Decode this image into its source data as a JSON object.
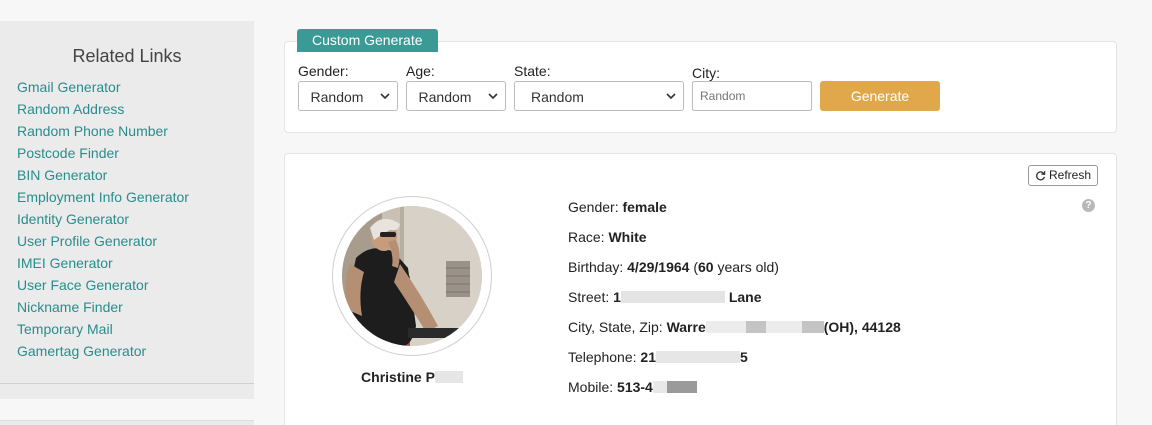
{
  "sidebar": {
    "title": "Related Links",
    "links": [
      "Gmail Generator",
      "Random Address",
      "Random Phone Number",
      "Postcode Finder",
      "BIN Generator",
      "Employment Info Generator",
      "Identity Generator",
      "User Profile Generator",
      "IMEI Generator",
      "User Face Generator",
      "Nickname Finder",
      "Temporary Mail",
      "Gamertag Generator"
    ]
  },
  "generator": {
    "tab_label": "Custom Generate",
    "gender_label": "Gender:",
    "gender_value": "Random",
    "age_label": "Age:",
    "age_value": "Random",
    "state_label": "State:",
    "state_value": "Random",
    "city_label": "City:",
    "city_placeholder": "Random",
    "generate_label": "Generate"
  },
  "profile": {
    "refresh_label": "Refresh",
    "name": "Christine P",
    "gender_label": "Gender:",
    "gender": "female",
    "race_label": "Race:",
    "race": "White",
    "birthday_label": "Birthday:",
    "birthday": "4/29/1964",
    "age": "60",
    "age_suffix": "years old)",
    "street_label": "Street:",
    "street_visible": "1",
    "street_tail": "Lane",
    "city_label": "City, State, Zip:",
    "city_start": "Warre",
    "city_tail": "(OH), 44128",
    "telephone_label": "Telephone:",
    "telephone_start": "21",
    "telephone_tail": "5",
    "mobile_label": "Mobile:",
    "mobile_start": "513-4"
  },
  "colors": {
    "accent": "#3a9a96",
    "link": "#2a8c8c",
    "generate_button": "#e0a84a"
  }
}
